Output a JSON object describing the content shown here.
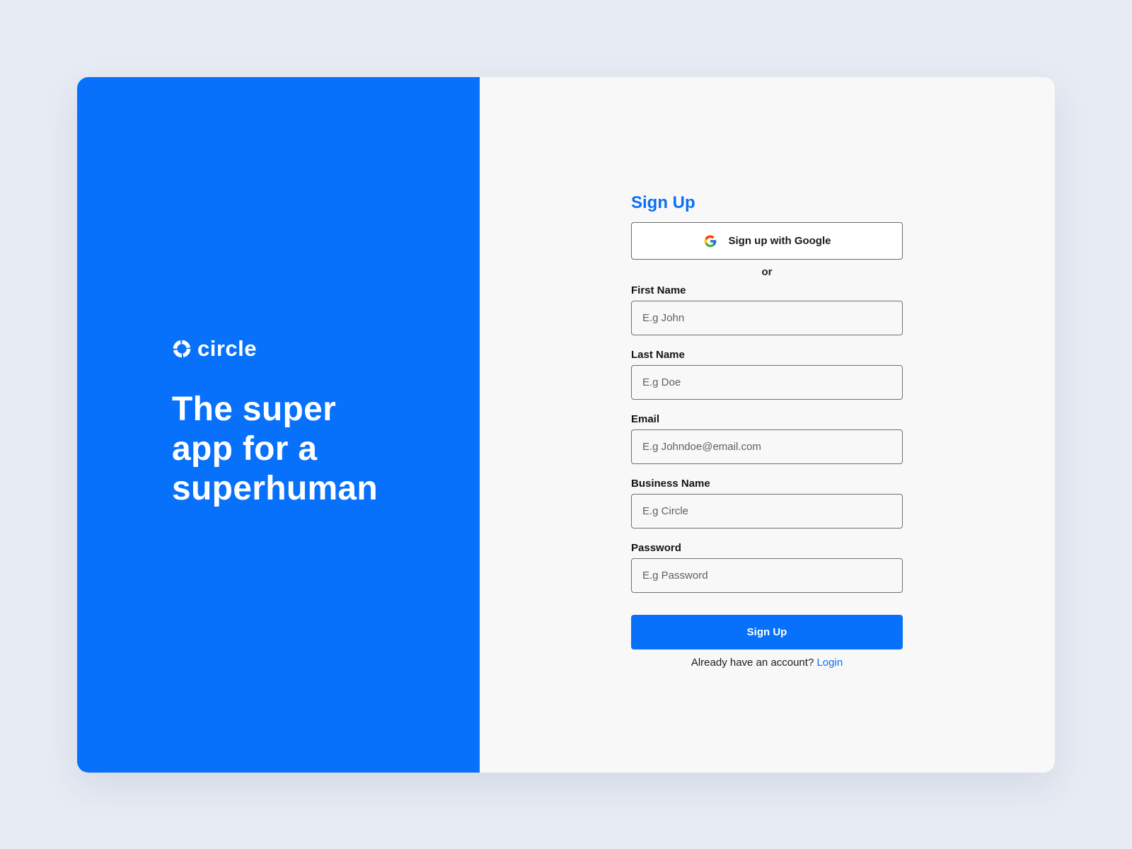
{
  "brand": {
    "name": "circle",
    "tagline": "The super app for a superhuman",
    "accent_color": "#0871fb",
    "logo_icon": "circle-logo-icon"
  },
  "signup": {
    "title": "Sign Up",
    "google_button_label": "Sign up with Google",
    "google_icon": "google-icon",
    "divider_text": "or",
    "fields": {
      "first_name": {
        "label": "First Name",
        "placeholder": "E.g John",
        "value": ""
      },
      "last_name": {
        "label": "Last Name",
        "placeholder": "E.g Doe",
        "value": ""
      },
      "email": {
        "label": "Email",
        "placeholder": "E.g Johndoe@email.com",
        "value": ""
      },
      "business_name": {
        "label": "Business Name",
        "placeholder": "E.g Circle",
        "value": ""
      },
      "password": {
        "label": "Password",
        "placeholder": "E.g Password",
        "value": ""
      }
    },
    "submit_label": "Sign Up",
    "login_prompt": "Already have an account?",
    "login_link": "Login"
  }
}
